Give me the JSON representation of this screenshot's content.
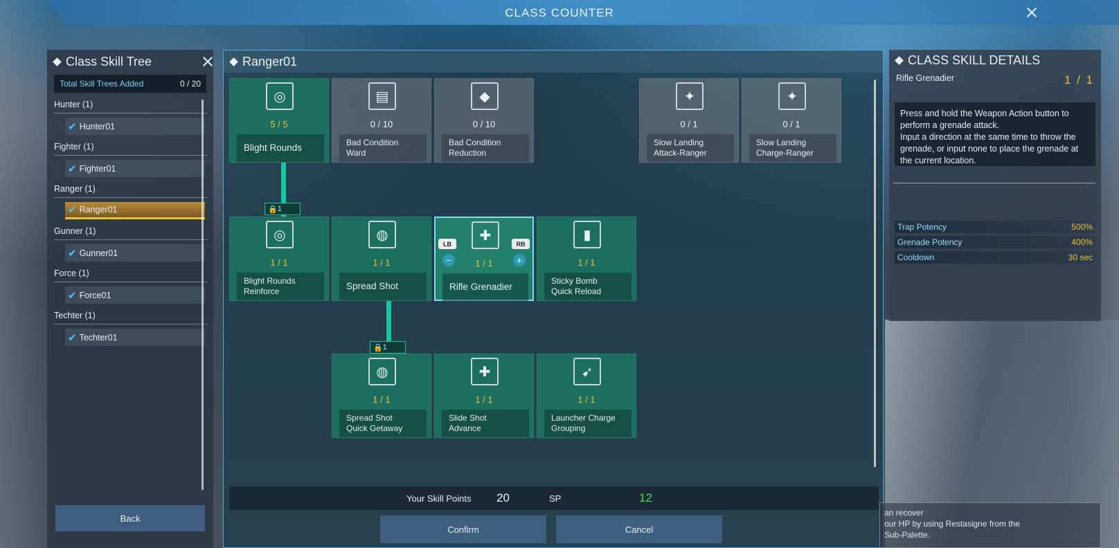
{
  "window": {
    "title": "CLASS COUNTER"
  },
  "left_panel": {
    "title": "Class Skill Tree",
    "total_label": "Total Skill Trees Added",
    "total_value": "0 / 20",
    "groups": [
      {
        "name": "Hunter (1)",
        "item": "Hunter01"
      },
      {
        "name": "Fighter (1)",
        "item": "Fighter01"
      },
      {
        "name": "Ranger (1)",
        "item": "Ranger01",
        "selected": true
      },
      {
        "name": "Gunner (1)",
        "item": "Gunner01"
      },
      {
        "name": "Force (1)",
        "item": "Force01"
      },
      {
        "name": "Techter (1)",
        "item": "Techter01"
      }
    ],
    "back_label": "Back"
  },
  "center_panel": {
    "title": "Ranger01",
    "skills": [
      {
        "name": "Blight Rounds",
        "count": "5 / 5",
        "icon": "blight-rounds-icon"
      },
      {
        "name": "Bad Condition\nWard",
        "count": "0 / 10",
        "icon": "condition-ward-icon"
      },
      {
        "name": "Bad Condition\nReduction",
        "count": "0 / 10",
        "icon": "condition-reduction-icon"
      },
      {
        "name": "Slow Landing\nAttack-Ranger",
        "count": "0 / 1",
        "icon": "slow-landing-attack-icon"
      },
      {
        "name": "Slow Landing\nCharge-Ranger",
        "count": "0 / 1",
        "icon": "slow-landing-charge-icon"
      },
      {
        "name": "Blight Rounds\nReinforce",
        "count": "1 / 1",
        "icon": "blight-reinforce-icon"
      },
      {
        "name": "Spread Shot",
        "count": "1 / 1",
        "icon": "spread-shot-icon"
      },
      {
        "name": "Rifle Grenadier",
        "count": "1 / 1",
        "icon": "rifle-grenadier-icon"
      },
      {
        "name": "Sticky Bomb\nQuick Reload",
        "count": "1 / 1",
        "icon": "sticky-bomb-icon"
      },
      {
        "name": "Spread Shot\nQuick Getaway",
        "count": "1 / 1",
        "icon": "quick-getaway-icon"
      },
      {
        "name": "Slide Shot\nAdvance",
        "count": "1 / 1",
        "icon": "slide-shot-icon"
      },
      {
        "name": "Launcher Charge\nGrouping",
        "count": "1 / 1",
        "icon": "launcher-charge-icon"
      }
    ],
    "lock_text": "1",
    "lb_label": "LB",
    "rb_label": "RB",
    "minus": "−",
    "plus": "+",
    "skill_points_label": "Your Skill Points",
    "skill_points_value": "20",
    "sp_label": "SP",
    "sp_value": "12",
    "confirm_label": "Confirm",
    "cancel_label": "Cancel"
  },
  "right_panel": {
    "title": "CLASS SKILL DETAILS",
    "skill_name": "Rifle Grenadier",
    "skill_points": "1 / 1",
    "description": "Press and hold the Weapon Action button to perform a grenade attack.\nInput a direction at the same time to throw the grenade, or input none to place the grenade at the current location.",
    "stats": [
      {
        "label": "Trap Potency",
        "value": "500%"
      },
      {
        "label": "Grenade Potency",
        "value": "400%"
      },
      {
        "label": "Cooldown",
        "value": "30 sec"
      }
    ]
  },
  "tip": {
    "text": "an recover\nour HP by using Restasigne from the\nSub-Palette."
  },
  "colors": {
    "accent": "#19c6a2",
    "gold": "#f2c232",
    "node": "#1c6e5e",
    "highlight": "#4ca9d8"
  }
}
